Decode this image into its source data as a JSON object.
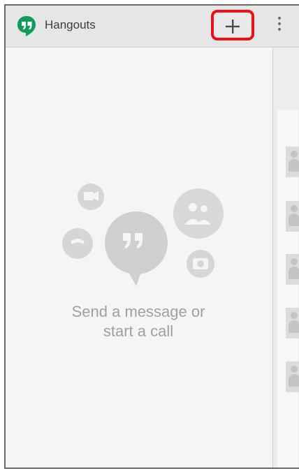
{
  "actionbar": {
    "app_icon": "hangouts-logo-icon",
    "title": "Hangouts",
    "add_icon": "plus-icon",
    "overflow_icon": "more-vert-icon"
  },
  "empty_state": {
    "line1": "Send a message or",
    "line2": "start a call"
  },
  "colors": {
    "brand_green": "#0f9d58",
    "highlight_red": "#e3141c"
  }
}
